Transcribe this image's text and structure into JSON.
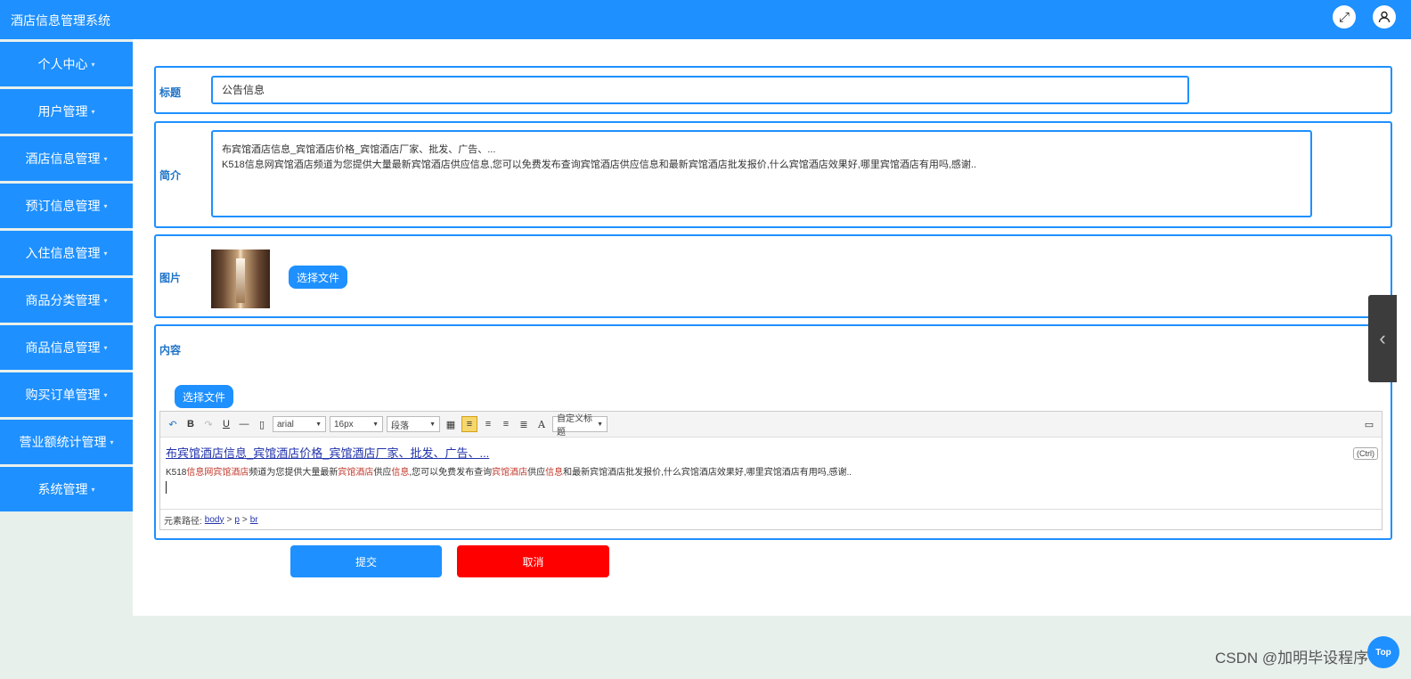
{
  "app": {
    "title": "酒店信息管理系统"
  },
  "header": {
    "fullscreen_icon": "expand-icon",
    "user_icon": "user-icon"
  },
  "sidebar": {
    "items": [
      {
        "label": "个人中心"
      },
      {
        "label": "用户管理"
      },
      {
        "label": "酒店信息管理"
      },
      {
        "label": "预订信息管理"
      },
      {
        "label": "入住信息管理"
      },
      {
        "label": "商品分类管理"
      },
      {
        "label": "商品信息管理"
      },
      {
        "label": "购买订单管理"
      },
      {
        "label": "营业额统计管理"
      },
      {
        "label": "系统管理"
      }
    ],
    "caret": "▾"
  },
  "form": {
    "title_label": "标题",
    "title_value": "公告信息",
    "intro_label": "简介",
    "intro_line1": "布宾馆酒店信息_宾馆酒店价格_宾馆酒店厂家、批发、广告、...",
    "intro_line2": "K518信息网宾馆酒店频道为您提供大量最新宾馆酒店供应信息,您可以免费发布查询宾馆酒店供应信息和最新宾馆酒店批发报价,什么宾馆酒店效果好,哪里宾馆酒店有用吗,感谢..",
    "image_label": "图片",
    "choose_file": "选择文件",
    "content_label": "内容",
    "content_choose_file": "选择文件",
    "submit": "提交",
    "cancel": "取消"
  },
  "editor": {
    "font_family": "arial",
    "font_size": "16px",
    "paragraph": "段落",
    "custom_title": "自定义标题",
    "link_text": "布宾馆酒店信息_宾馆酒店价格_宾馆酒店厂家、批发、广告、...",
    "line2_parts": {
      "p1": "K518",
      "p2": "信息网宾馆酒店",
      "p3": "频道为您提供大量最新",
      "p4": "宾馆酒店",
      "p5": "供应",
      "p6": "信息",
      "p7": ",您可以免费发布查询",
      "p8": "宾馆酒店",
      "p9": "供应",
      "p10": "信息",
      "p11": "和最新宾馆酒店批发报价,什么宾馆酒店效果好,哪里宾馆酒店有用吗,感谢.."
    },
    "paste_badge": "(Ctrl)",
    "path_label": "元素路径:",
    "path": [
      "body",
      "p",
      "br"
    ],
    "path_sep": ">"
  },
  "watermark": "CSDN @加明毕设程序",
  "top_button": "Top",
  "colors": {
    "primary": "#1e90ff",
    "cancel": "#ff0000"
  }
}
